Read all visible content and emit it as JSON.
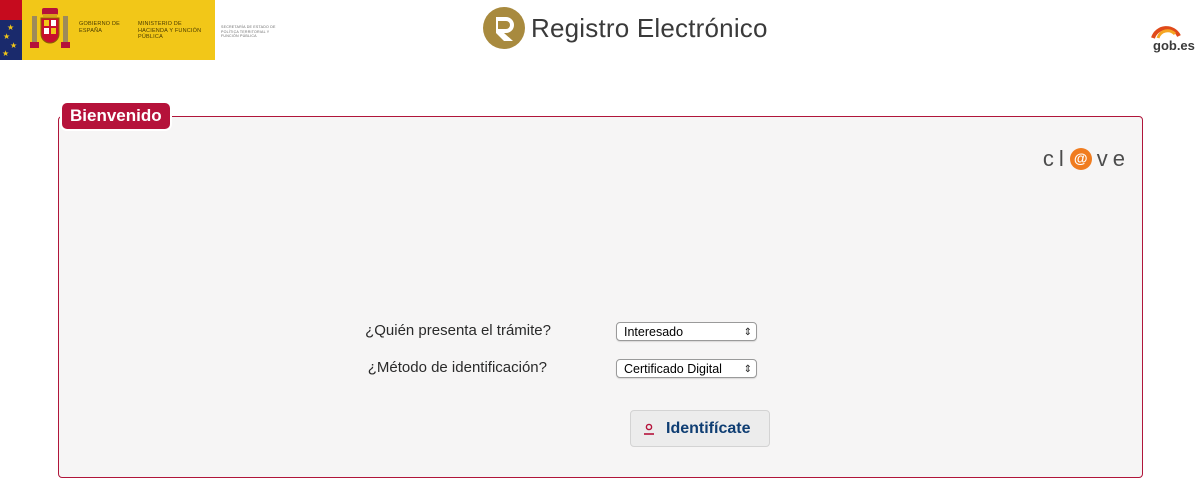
{
  "header": {
    "gov_line1": "Gobierno de España",
    "gov_line2": "Ministerio de Hacienda y Función Pública",
    "gov_line3": "Secretaría de Estado de Política Territorial y Función Pública",
    "app_title": "Registro Electrónico",
    "gobes_label": "gob.es"
  },
  "panel": {
    "tab_label": "Bienvenido",
    "clave_left": "cl",
    "clave_at": "@",
    "clave_right": "ve"
  },
  "form": {
    "q1_label": "¿Quién presenta el trámite?",
    "q1_value": "Interesado",
    "q2_label": "¿Método de identificación?",
    "q2_value": "Certificado Digital",
    "submit_label": "Identifícate"
  },
  "colors": {
    "accent": "#b5123a",
    "button_text": "#0f3e73",
    "gov_yellow": "#f2c718",
    "clave_orange": "#f07c1f"
  },
  "icons": {
    "select_arrow": "updown-arrows-icon",
    "submit_icon": "user-icon"
  }
}
